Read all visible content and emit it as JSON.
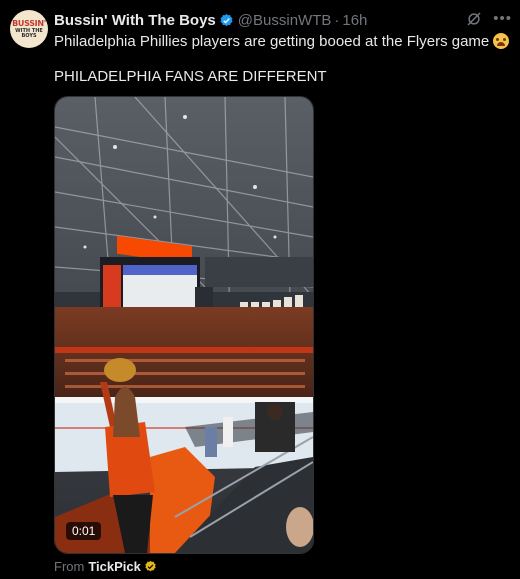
{
  "tweet": {
    "display_name": "Bussin' With The Boys",
    "handle": "@BussinWTB",
    "separator": "·",
    "time": "16h",
    "text_line1": "Philadelphia Phillies players are getting booed at the Flyers game",
    "text_line2": "PHILADELPHIA FANS ARE DIFFERENT",
    "emoji": "loudly-crying-face",
    "avatar_text_line1": "BUSSIN'",
    "avatar_text_line2": "WITH THE BOYS",
    "video_time": "0:01",
    "from_label": "From",
    "from_name": "TickPick"
  },
  "icons": {
    "verified": "verified-badge-icon",
    "grok": "grok-icon",
    "more": "more-options-icon",
    "affiliate": "gold-verified-badge-icon"
  },
  "colors": {
    "background": "#000000",
    "text": "#e7e9ea",
    "secondary": "#71767b",
    "verified_blue": "#1d9bf0",
    "gold": "#e2b719",
    "flyers_orange": "#f74902"
  }
}
